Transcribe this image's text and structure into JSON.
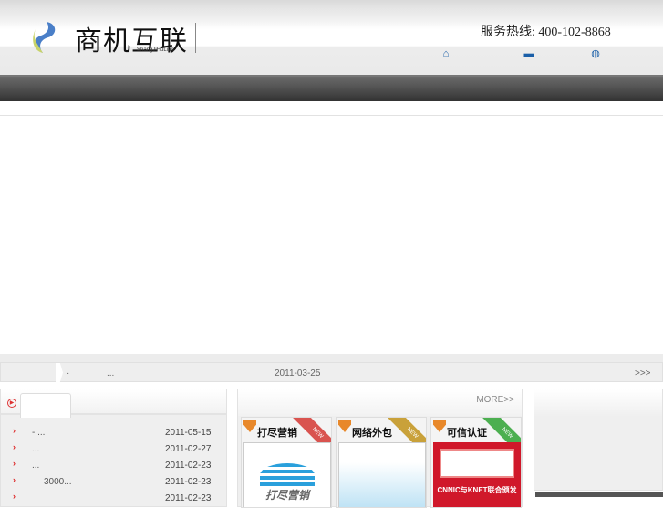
{
  "header": {
    "logo_text": "商机互联",
    "logo_sub": "ShangJiHuLian",
    "phone": "服务热线: 400-102-8868",
    "icons": [
      "home-icon",
      "folder-icon",
      "globe-icon"
    ]
  },
  "ticker": {
    "dot": "·",
    "title": "...",
    "date": "2011-03-25",
    "more": ">>>"
  },
  "news": {
    "items": [
      {
        "title": "-   ...",
        "date": "2011-05-15"
      },
      {
        "title": "   ...",
        "date": "2011-02-27"
      },
      {
        "title": "   ...",
        "date": "2011-02-23"
      },
      {
        "title": "3000...",
        "date": "2011-02-23"
      },
      {
        "title": "",
        "date": "2011-02-23"
      }
    ]
  },
  "services": {
    "more": "MORE>>",
    "cards": [
      {
        "title": "打尽营销",
        "badge": "NEW",
        "img_text": "打尽营销",
        "ribbon": "#d9534f"
      },
      {
        "title": "网络外包",
        "badge": "NEW",
        "img_text": "",
        "ribbon": "#c9a13a"
      },
      {
        "title": "可信认证",
        "badge": "NEW",
        "img_text": "CNNIC与KNET联合颁发",
        "ribbon": "#4caf50"
      }
    ]
  }
}
